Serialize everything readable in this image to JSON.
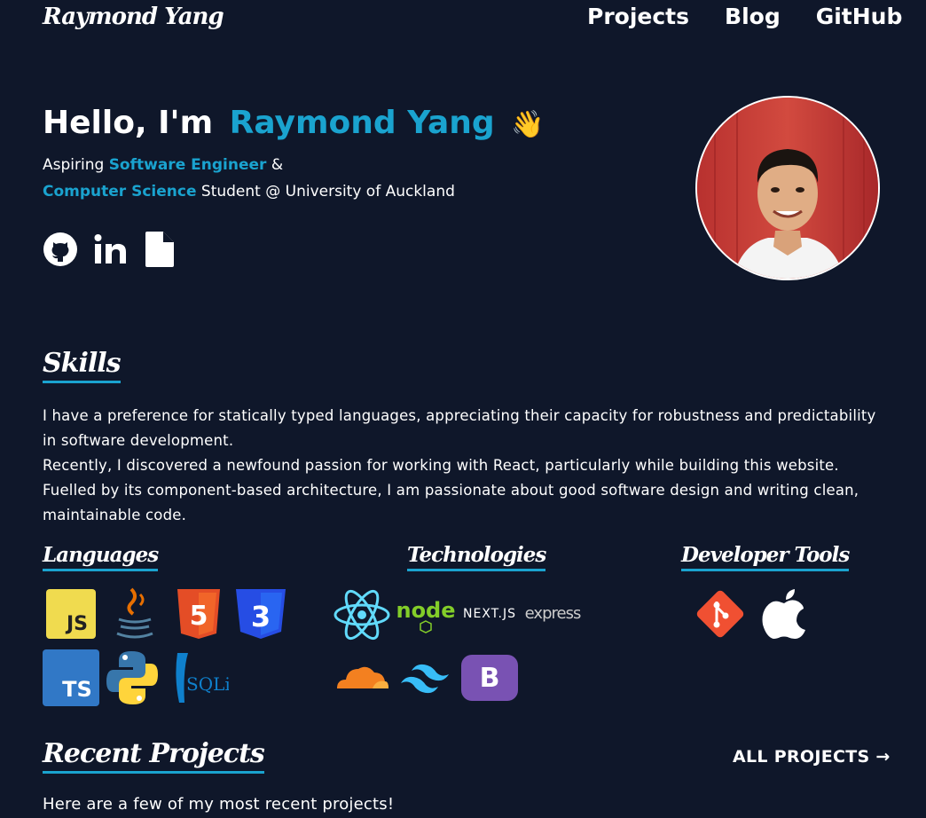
{
  "header": {
    "logo": "Raymond Yang",
    "nav": [
      "Projects",
      "Blog",
      "GitHub"
    ]
  },
  "hero": {
    "greeting": "Hello, I'm",
    "name": "Raymond Yang",
    "wave": "👋",
    "line1_prefix": "Aspiring",
    "line1_role": "Software Engineer",
    "line1_suffix": "&",
    "line2_field": "Computer Science",
    "line2_rest": "Student @ University of Auckland",
    "social_icons": [
      "github-icon",
      "linkedin-icon",
      "resume-file-icon"
    ]
  },
  "skills": {
    "heading": "Skills",
    "para1": "I have a preference for statically typed languages, appreciating their capacity for robustness and predictability in software development.",
    "para2": "Recently, I discovered a newfound passion for working with React, particularly while building this website. Fuelled by its component-based architecture, I am passionate about good software design and writing clean, maintainable code."
  },
  "languages": {
    "heading": "Languages",
    "items": [
      {
        "name": "javascript-icon",
        "label": "JS"
      },
      {
        "name": "java-icon",
        "label": "☕"
      },
      {
        "name": "html5-icon",
        "label": "5"
      },
      {
        "name": "css3-icon",
        "label": "3"
      },
      {
        "name": "typescript-icon",
        "label": "TS"
      },
      {
        "name": "python-icon",
        "label": ""
      },
      {
        "name": "sqlite-icon",
        "label": "SQLite"
      }
    ]
  },
  "technologies": {
    "heading": "Technologies",
    "items": [
      {
        "name": "react-icon",
        "label": ""
      },
      {
        "name": "nodejs-icon",
        "label": "node"
      },
      {
        "name": "nextjs-icon",
        "label": "NEXT.JS"
      },
      {
        "name": "express-icon",
        "label": "express"
      },
      {
        "name": "cloudflare-icon",
        "label": ""
      },
      {
        "name": "tailwind-icon",
        "label": ""
      },
      {
        "name": "bootstrap-icon",
        "label": "B"
      }
    ]
  },
  "devtools": {
    "heading": "Developer Tools",
    "items": [
      {
        "name": "git-icon"
      },
      {
        "name": "apple-icon"
      }
    ]
  },
  "recent": {
    "heading": "Recent Projects",
    "all_link": "ALL PROJECTS →",
    "intro": "Here are a few of my most recent projects!"
  },
  "colors": {
    "background": "#0f172a",
    "accent": "#1aa3cf"
  }
}
